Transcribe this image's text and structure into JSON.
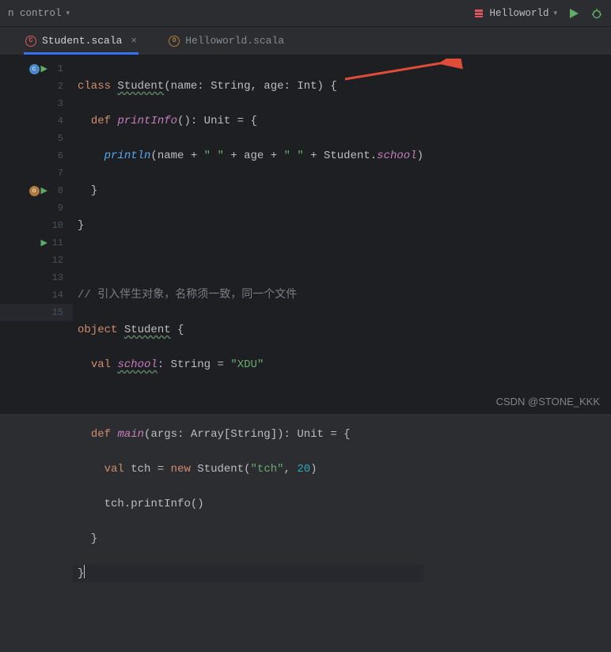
{
  "toolbar": {
    "left_label": "n control",
    "run_config": "Helloworld"
  },
  "tabs": [
    {
      "name": "Student.scala",
      "active": true
    },
    {
      "name": "Helloworld.scala",
      "active": false
    }
  ],
  "gutter": [
    {
      "n": 1,
      "icons": [
        "class",
        "run"
      ]
    },
    {
      "n": 2
    },
    {
      "n": 3
    },
    {
      "n": 4
    },
    {
      "n": 5
    },
    {
      "n": 6
    },
    {
      "n": 7
    },
    {
      "n": 8,
      "icons": [
        "obj",
        "run"
      ]
    },
    {
      "n": 9
    },
    {
      "n": 10
    },
    {
      "n": 11,
      "icons": [
        "run"
      ]
    },
    {
      "n": 12
    },
    {
      "n": 13
    },
    {
      "n": 14
    },
    {
      "n": 15
    }
  ],
  "code": {
    "l1_kw1": "class",
    "l1_name": "Student",
    "l1_p1": "name",
    "l1_t1": "String",
    "l1_p2": "age",
    "l1_t2": "Int",
    "l2_kw": "def",
    "l2_fn": "printInfo",
    "l2_ret": "Unit",
    "l3_fn": "println",
    "l3_a1": "name",
    "l3_s1": "\" \"",
    "l3_a2": "age",
    "l3_s2": "\" \"",
    "l3_obj": "Student",
    "l3_field": "school",
    "l7_comment": "// 引入伴生对象，名称须一致，同一个文件",
    "l8_kw": "object",
    "l8_name": "Student",
    "l9_kw": "val",
    "l9_name": "school",
    "l9_type": "String",
    "l9_val": "\"XDU\"",
    "l11_kw": "def",
    "l11_fn": "main",
    "l11_p": "args",
    "l11_pt": "Array",
    "l11_pti": "String",
    "l11_ret": "Unit",
    "l12_kw": "val",
    "l12_name": "tch",
    "l12_new": "new",
    "l12_cls": "Student",
    "l12_a1": "\"tch\"",
    "l12_a2": "20",
    "l13_obj": "tch",
    "l13_fn": "printInfo"
  },
  "watermark": "CSDN @STONE_KKK",
  "left_label": "n"
}
